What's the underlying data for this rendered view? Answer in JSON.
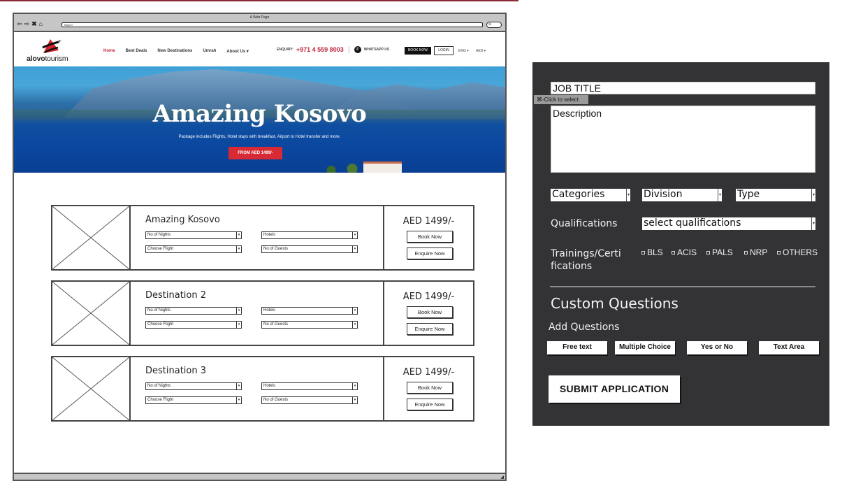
{
  "browser": {
    "window_title": "A Web Page",
    "url": "https://",
    "nav_icons": [
      "back-arrow-icon",
      "forward-arrow-icon",
      "close-x-icon",
      "home-icon"
    ]
  },
  "site": {
    "logo": {
      "bold": "alovo",
      "light": "tourism"
    },
    "nav": [
      {
        "label": "Home",
        "active": true
      },
      {
        "label": "Best Deals",
        "active": false
      },
      {
        "label": "New Destinations",
        "active": false
      },
      {
        "label": "Umrah",
        "active": false
      },
      {
        "label": "About Us ▾",
        "active": false
      }
    ],
    "enquiry_label": "ENQUIRY:",
    "phone": "+971 4 559 8003",
    "whatsapp_label": "WHATSAPP US",
    "book_now": "BOOK NOW",
    "login": "LOGIN",
    "language": "ENG ▾",
    "currency": "AED ▾",
    "accent_color": "#c0263b"
  },
  "hero": {
    "title": "Amazing Kosovo",
    "subtitle": "Package includes Flights, Hotel stays with breakfast, Airport to Hotel transfer and more.",
    "cta": "FROM AED 1499/-"
  },
  "packages": [
    {
      "title": "Amazing Kosovo",
      "selects": {
        "nights": "No of Nights",
        "hotels": "Hotels",
        "flight": "Choose Flight",
        "guests": "No of Guests"
      },
      "price": "AED 1499/-",
      "book": "Book Now",
      "enquire": "Enquire Now"
    },
    {
      "title": "Destination 2",
      "selects": {
        "nights": "No of Nights",
        "hotels": "Hotels",
        "flight": "Choose Flight",
        "guests": "No of Guests"
      },
      "price": "AED 1499/-",
      "book": "Book Now",
      "enquire": "Enquire Now"
    },
    {
      "title": "Destination 3",
      "selects": {
        "nights": "No of Nights",
        "hotels": "Hotels",
        "flight": "Choose Flight",
        "guests": "No of Guests"
      },
      "price": "AED 1499/-",
      "book": "Book Now",
      "enquire": "Enquire Now"
    }
  ],
  "form": {
    "job_title_placeholder": "JOB TITLE",
    "tooltip": "⌘-Click to select",
    "description_placeholder": "Description",
    "categories": "Categories",
    "division": "Division",
    "type": "Type",
    "qualifications_label": "Qualifications",
    "qualifications_select": "select qualifications",
    "trainings_label_line1": "Trainings/Certi",
    "trainings_label_line2": "fications",
    "trainings": [
      "BLS",
      "ACIS",
      "PALS",
      "NRP",
      "OTHERS"
    ],
    "custom_questions_heading": "Custom Questions",
    "add_questions_label": "Add Questions",
    "question_types": [
      "Free text",
      "Multiple Choice",
      "Yes or No",
      "Text Area"
    ],
    "submit": "SUBMIT APPLICATION"
  }
}
